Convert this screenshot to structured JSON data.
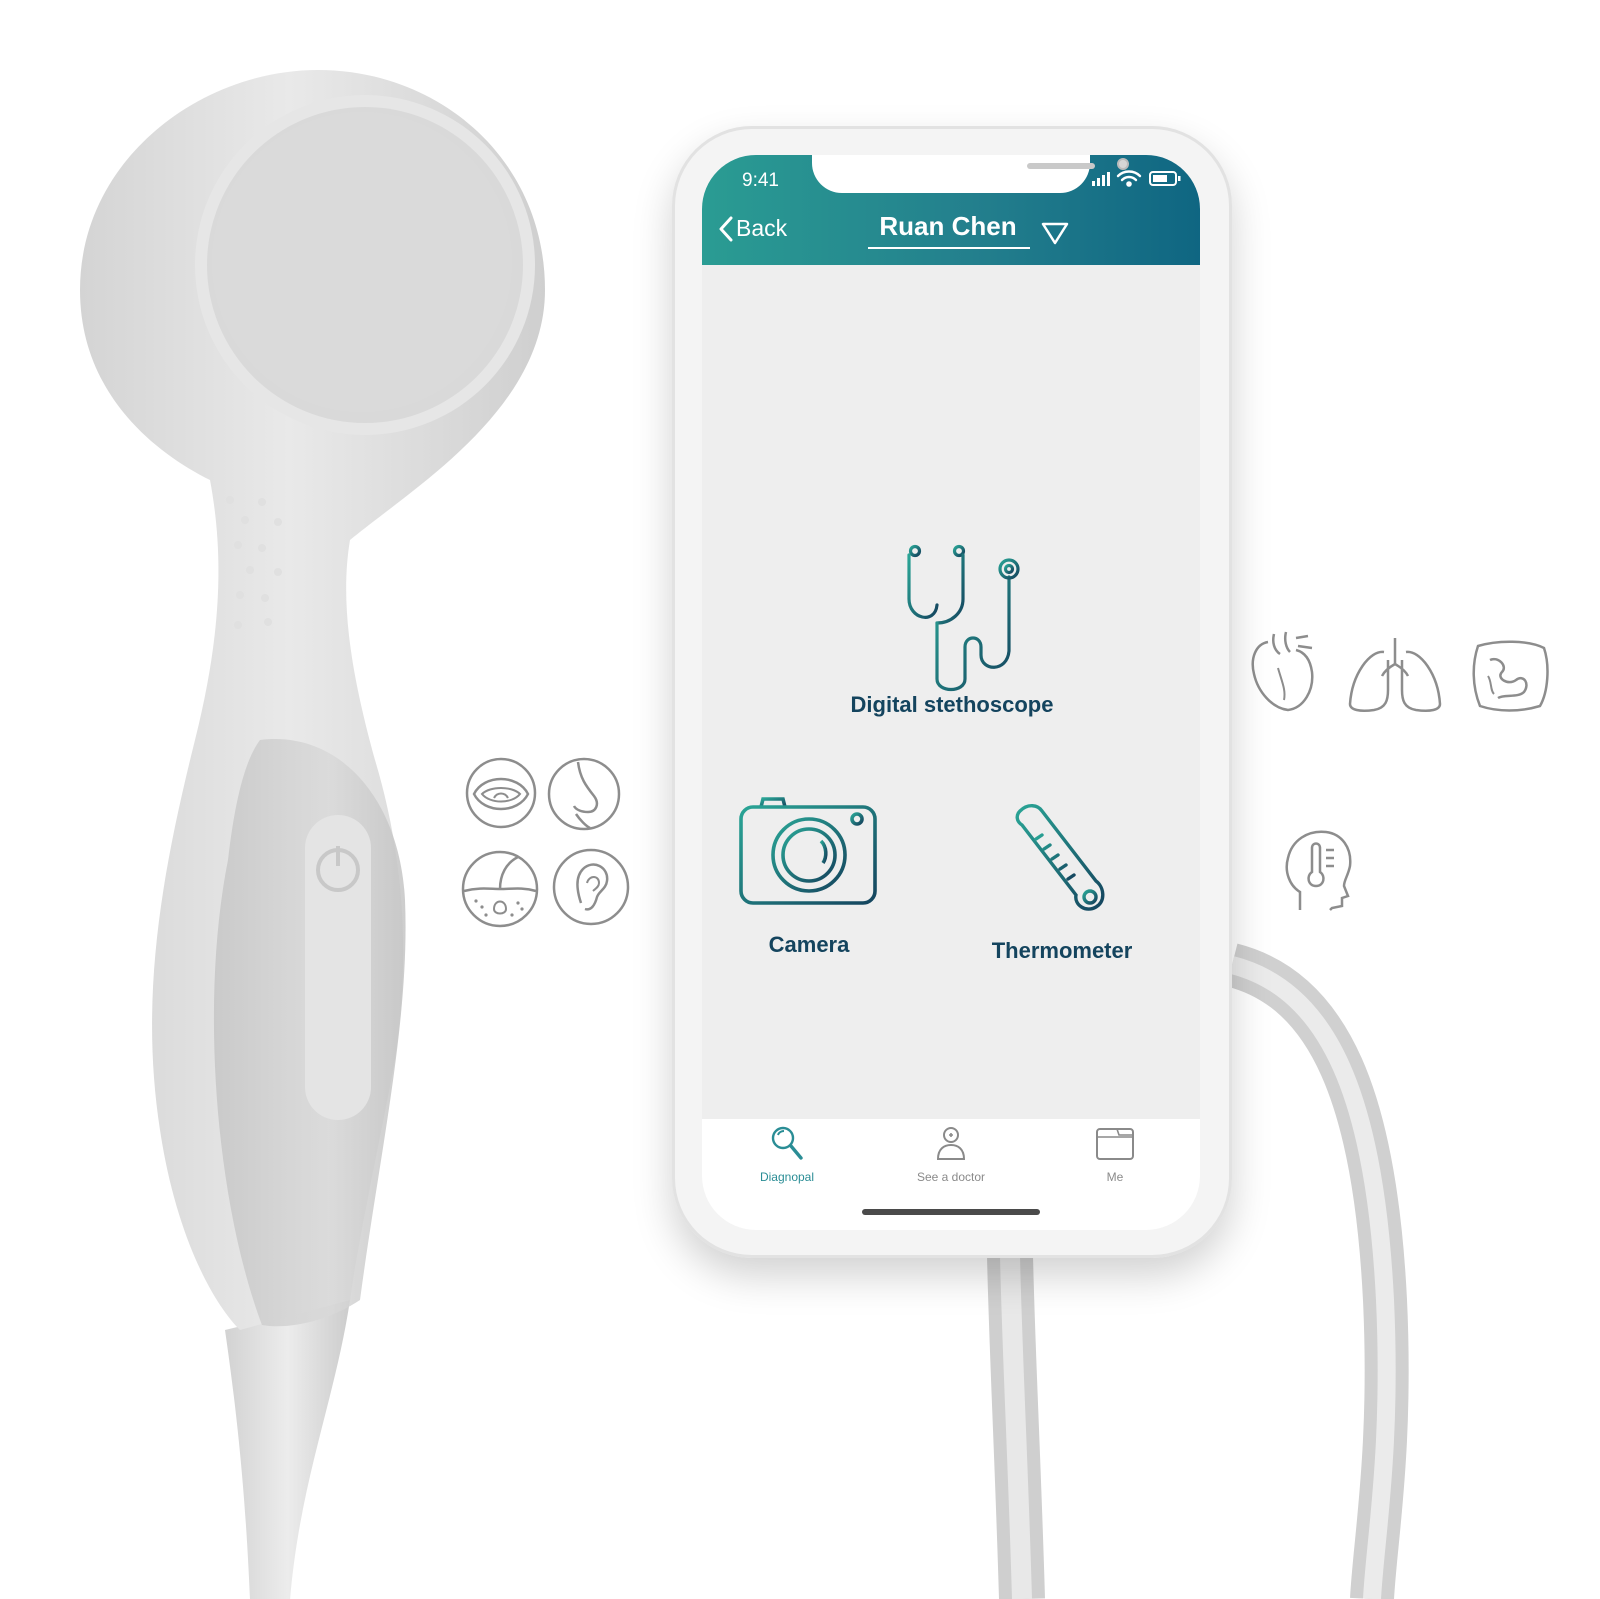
{
  "status_bar": {
    "time": "9:41"
  },
  "header": {
    "back_label": "Back",
    "user_name": "Ruan Chen"
  },
  "features": {
    "stethoscope_label": "Digital stethoscope",
    "camera_label": "Camera",
    "thermometer_label": "Thermometer"
  },
  "tabbar": {
    "tabs": [
      {
        "label": "Diagnopal",
        "icon": "magnifier-icon",
        "active": true
      },
      {
        "label": "See a doctor",
        "icon": "doctor-icon",
        "active": false
      },
      {
        "label": "Me",
        "icon": "folder-icon",
        "active": false
      }
    ]
  },
  "side_icons": {
    "left": [
      "mouth-icon",
      "nose-icon",
      "skin-icon",
      "ear-icon"
    ],
    "right": [
      "heart-icon",
      "lungs-icon",
      "intestine-icon",
      "head-temperature-icon"
    ]
  },
  "colors": {
    "header_start": "#2a9c93",
    "header_end": "#0f6682",
    "label_text": "#14445e",
    "active_tab": "#2a8d95"
  }
}
